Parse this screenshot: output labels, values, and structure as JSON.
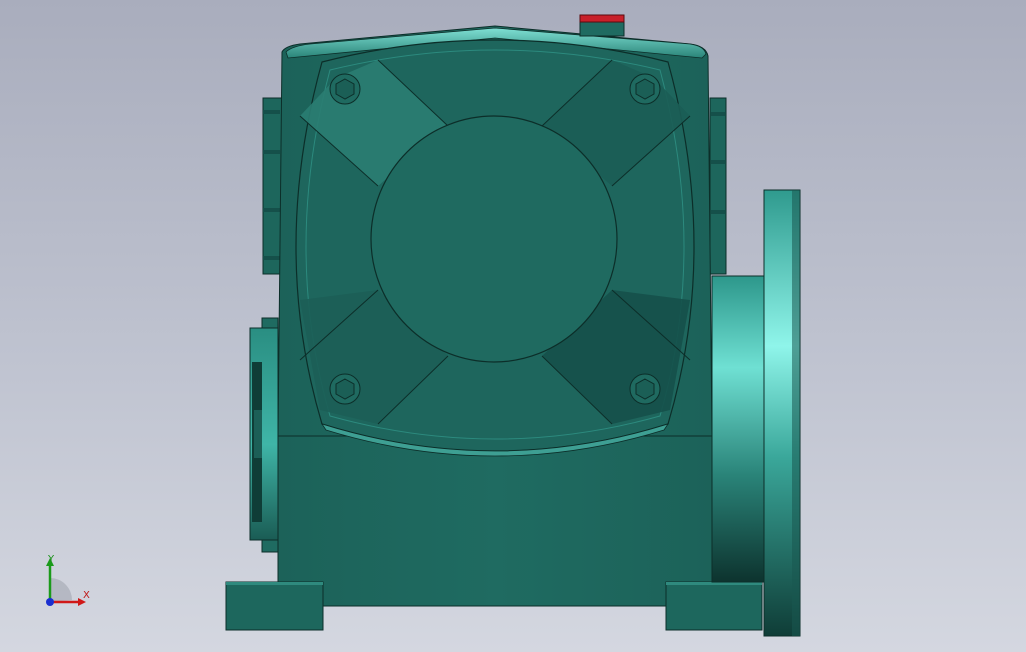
{
  "viewport": {
    "background_top": "#a9adbd",
    "background_bottom": "#d4d7e0"
  },
  "model": {
    "body_color": "#1f6b61",
    "highlight_color": "#8ff5ea",
    "shadow_color": "#0f3d37",
    "vent_plug_color": "#c8202a"
  },
  "triad": {
    "y_label": "Y",
    "x_label": "X",
    "y_color": "#1a9a1a",
    "x_color": "#d01818",
    "z_color": "#1a2fd0"
  }
}
